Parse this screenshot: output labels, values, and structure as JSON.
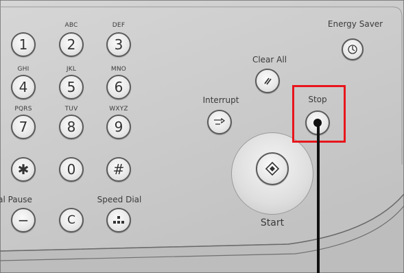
{
  "keypad": {
    "rows": [
      {
        "keys": [
          {
            "glyph": "1",
            "letters": ""
          },
          {
            "glyph": "2",
            "letters": "ABC"
          },
          {
            "glyph": "3",
            "letters": "DEF"
          }
        ]
      },
      {
        "keys": [
          {
            "glyph": "4",
            "letters": "GHI"
          },
          {
            "glyph": "5",
            "letters": "JKL"
          },
          {
            "glyph": "6",
            "letters": "MNO"
          }
        ]
      },
      {
        "keys": [
          {
            "glyph": "7",
            "letters": "PQRS"
          },
          {
            "glyph": "8",
            "letters": "TUV"
          },
          {
            "glyph": "9",
            "letters": "WXYZ"
          }
        ]
      },
      {
        "keys": [
          {
            "glyph": "✱",
            "letters": ""
          },
          {
            "glyph": "0",
            "letters": ""
          },
          {
            "glyph": "#",
            "letters": ""
          }
        ]
      }
    ]
  },
  "labels": {
    "abc": "ABC",
    "def": "DEF",
    "ghi": "GHI",
    "jkl": "JKL",
    "mno": "MNO",
    "pqrs": "PQRS",
    "tuv": "TUV",
    "wxyz": "WXYZ",
    "dial_pause": "al Pause",
    "speed_dial": "Speed Dial",
    "energy_saver": "Energy Saver",
    "clear_all": "Clear All",
    "interrupt": "Interrupt",
    "stop": "Stop",
    "start": "Start"
  },
  "keys": {
    "k1": "1",
    "k2": "2",
    "k3": "3",
    "k4": "4",
    "k5": "5",
    "k6": "6",
    "k7": "7",
    "k8": "8",
    "k9": "9",
    "kstar": "✱",
    "k0": "0",
    "khash": "#",
    "dial_pause": "−",
    "clear": "C"
  },
  "colors": {
    "highlight": "#e8151b",
    "panel": "#cfcfcf",
    "key_border": "#5a5a5a"
  },
  "icons": {
    "energy_saver": "power-icon",
    "clear_all": "clear-all-icon",
    "interrupt": "interrupt-icon",
    "stop": "stop-icon",
    "start": "start-diamond-icon",
    "speed_dial": "speed-dial-icon"
  }
}
